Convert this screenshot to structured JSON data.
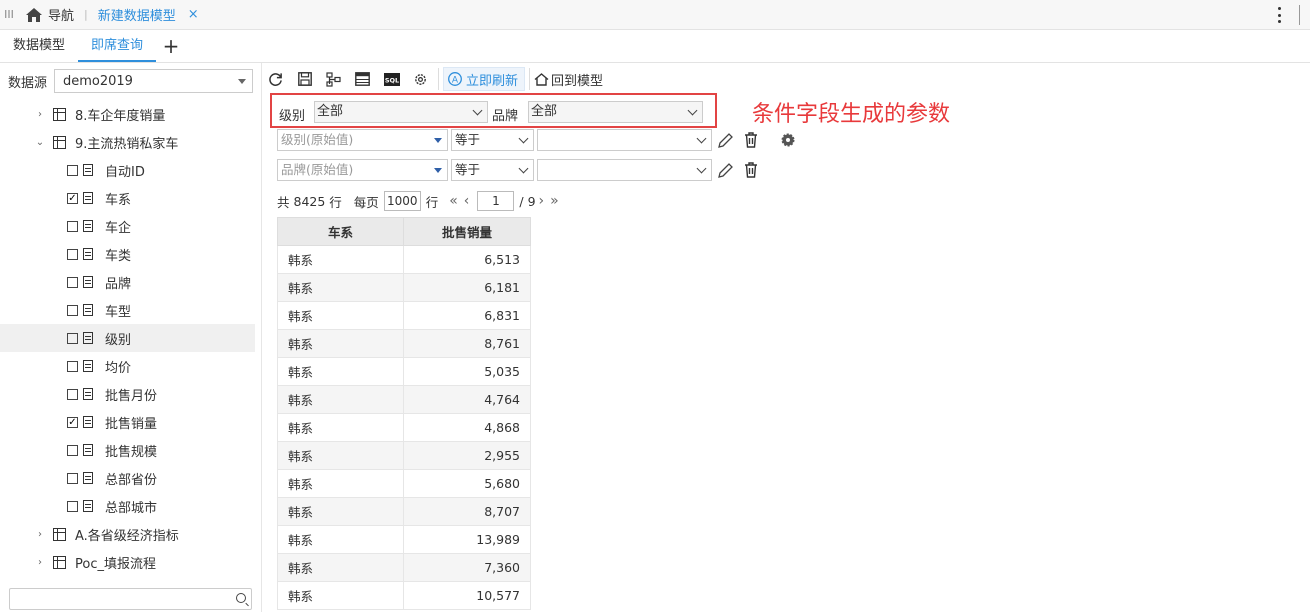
{
  "topbar": {
    "grip": "III",
    "nav_label": "导航",
    "active_tab": "新建数据模型",
    "close_glyph": "×"
  },
  "subtabs": [
    {
      "label": "数据模型"
    },
    {
      "label": "即席查询"
    }
  ],
  "add_tab": "+",
  "datasource": {
    "label": "数据源",
    "value": "demo2019"
  },
  "tree": [
    {
      "type": "table",
      "expanded": false,
      "label": "8.车企年度销量"
    },
    {
      "type": "table",
      "expanded": true,
      "label": "9.主流热销私家车"
    },
    {
      "type": "field",
      "checked": false,
      "label": "自动ID"
    },
    {
      "type": "field",
      "checked": true,
      "label": "车系"
    },
    {
      "type": "field",
      "checked": false,
      "label": "车企"
    },
    {
      "type": "field",
      "checked": false,
      "label": "车类"
    },
    {
      "type": "field",
      "checked": false,
      "label": "品牌"
    },
    {
      "type": "field",
      "checked": false,
      "label": "车型"
    },
    {
      "type": "field",
      "checked": false,
      "label": "级别",
      "selected": true
    },
    {
      "type": "field",
      "checked": false,
      "label": "均价"
    },
    {
      "type": "field",
      "checked": false,
      "label": "批售月份"
    },
    {
      "type": "field",
      "checked": true,
      "label": "批售销量"
    },
    {
      "type": "field",
      "checked": false,
      "label": "批售规模"
    },
    {
      "type": "field",
      "checked": false,
      "label": "总部省份"
    },
    {
      "type": "field",
      "checked": false,
      "label": "总部城市"
    },
    {
      "type": "table",
      "expanded": false,
      "label": "A.各省级经济指标"
    },
    {
      "type": "table",
      "expanded": false,
      "label": "Poc_填报流程"
    }
  ],
  "toolbar": {
    "refresh_now": "立即刷新",
    "back_to_model": "回到模型",
    "sql": "SQL"
  },
  "params": [
    {
      "label": "级别",
      "value": "全部"
    },
    {
      "label": "品牌",
      "value": "全部"
    }
  ],
  "annotation": "条件字段生成的参数",
  "filters": [
    {
      "field": "级别(原始值)",
      "op": "等于",
      "value": ""
    },
    {
      "field": "品牌(原始值)",
      "op": "等于",
      "value": ""
    }
  ],
  "pager": {
    "total_prefix": "共",
    "total": "8425",
    "total_unit": "行",
    "per_page_label": "每页",
    "per_page": "1000",
    "per_page_unit": "行",
    "page": "1",
    "pages": "/ 9"
  },
  "table": {
    "headers": [
      "车系",
      "批售销量"
    ],
    "rows": [
      [
        "韩系",
        "6,513"
      ],
      [
        "韩系",
        "6,181"
      ],
      [
        "韩系",
        "6,831"
      ],
      [
        "韩系",
        "8,761"
      ],
      [
        "韩系",
        "5,035"
      ],
      [
        "韩系",
        "4,764"
      ],
      [
        "韩系",
        "4,868"
      ],
      [
        "韩系",
        "2,955"
      ],
      [
        "韩系",
        "5,680"
      ],
      [
        "韩系",
        "8,707"
      ],
      [
        "韩系",
        "13,989"
      ],
      [
        "韩系",
        "7,360"
      ],
      [
        "韩系",
        "10,577"
      ]
    ]
  },
  "colors": {
    "accent": "#2f8fdc",
    "highlight": "#e24444"
  }
}
